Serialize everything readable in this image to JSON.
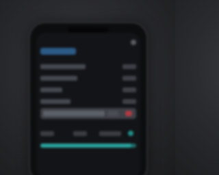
{
  "header": {
    "title": ""
  },
  "rows": [
    {
      "label": "",
      "value": ""
    },
    {
      "label": "",
      "value": ""
    },
    {
      "label": "",
      "value": ""
    },
    {
      "label": "",
      "value": ""
    }
  ],
  "toolbar": {
    "label": ""
  },
  "footer": {
    "left": "",
    "middle": "",
    "right": ""
  },
  "progress": 0.95,
  "colors": {
    "accent": "#2b5a86",
    "alert": "#b23a44",
    "teal": "#2aa39e"
  }
}
